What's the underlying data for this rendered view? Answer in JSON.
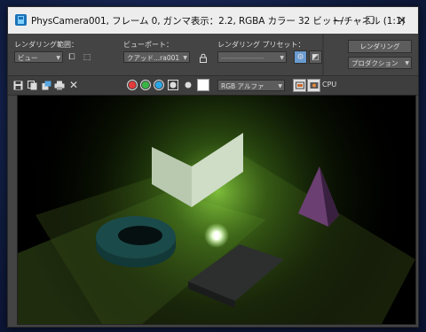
{
  "window": {
    "title": "PhysCamera001, フレーム 0, ガンマ表示：2.2, RGBA カラー 32 ビット/チャネル (1:1)",
    "app_icon": "3ds-max-render-icon",
    "minimize_glyph": "—",
    "maximize_glyph": "☐",
    "close_glyph": "✕"
  },
  "controls": {
    "render_area_label": "レンダリング範囲：",
    "render_area_value": "ビュー",
    "viewport_label": "ビューポート：",
    "viewport_value": "クアッド...ra001",
    "preset_label": "レンダリング プリセット：",
    "preset_value": "------------------",
    "render_button": "レンダリング",
    "production_value": "プロダクション"
  },
  "toolbar": {
    "channel_value": "RGB アルファ",
    "cpu_label": "CPU",
    "colors": {
      "red": "#e33b3b",
      "green": "#38b544",
      "blue": "#2aa6e6"
    }
  }
}
